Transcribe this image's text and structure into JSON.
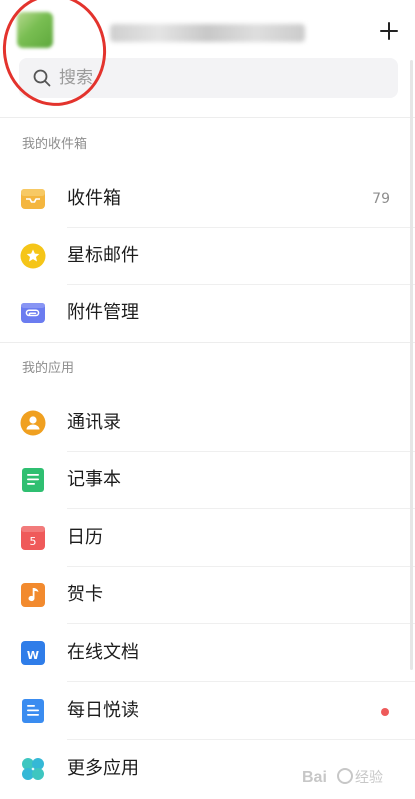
{
  "header": {
    "avatar_icon": "avatar-image",
    "account_name": "",
    "add_button_icon": "plus-icon"
  },
  "search": {
    "placeholder": "搜索",
    "icon": "search-icon"
  },
  "sections": [
    {
      "title": "我的收件箱",
      "items": [
        {
          "label": "收件箱",
          "icon": "inbox-tray-icon",
          "color": "#f4b63f",
          "count": "79"
        },
        {
          "label": "星标邮件",
          "icon": "star-icon",
          "color": "#f5c518"
        },
        {
          "label": "附件管理",
          "icon": "attachment-icon",
          "color": "#6b7cf0"
        }
      ]
    },
    {
      "title": "我的应用",
      "items": [
        {
          "label": "通讯录",
          "icon": "contacts-icon",
          "color": "#f0a020"
        },
        {
          "label": "记事本",
          "icon": "notepad-icon",
          "color": "#2fbf71"
        },
        {
          "label": "日历",
          "icon": "calendar-icon",
          "color": "#ef5a5a",
          "glyph": "5"
        },
        {
          "label": "贺卡",
          "icon": "greeting-card-icon",
          "color": "#f28a2e"
        },
        {
          "label": "在线文档",
          "icon": "online-doc-icon",
          "color": "#2f7de9",
          "glyph": "W"
        },
        {
          "label": "每日悦读",
          "icon": "daily-reading-icon",
          "color": "#3a8cf0",
          "badge_color": "#ee5a5a"
        },
        {
          "label": "更多应用",
          "icon": "more-apps-icon",
          "color": "#3ec6c0"
        }
      ]
    }
  ],
  "colors": {
    "annotation_ring": "#e3332d",
    "search_background": "#f3f3f5",
    "secondary_text": "#8e8e8e"
  }
}
